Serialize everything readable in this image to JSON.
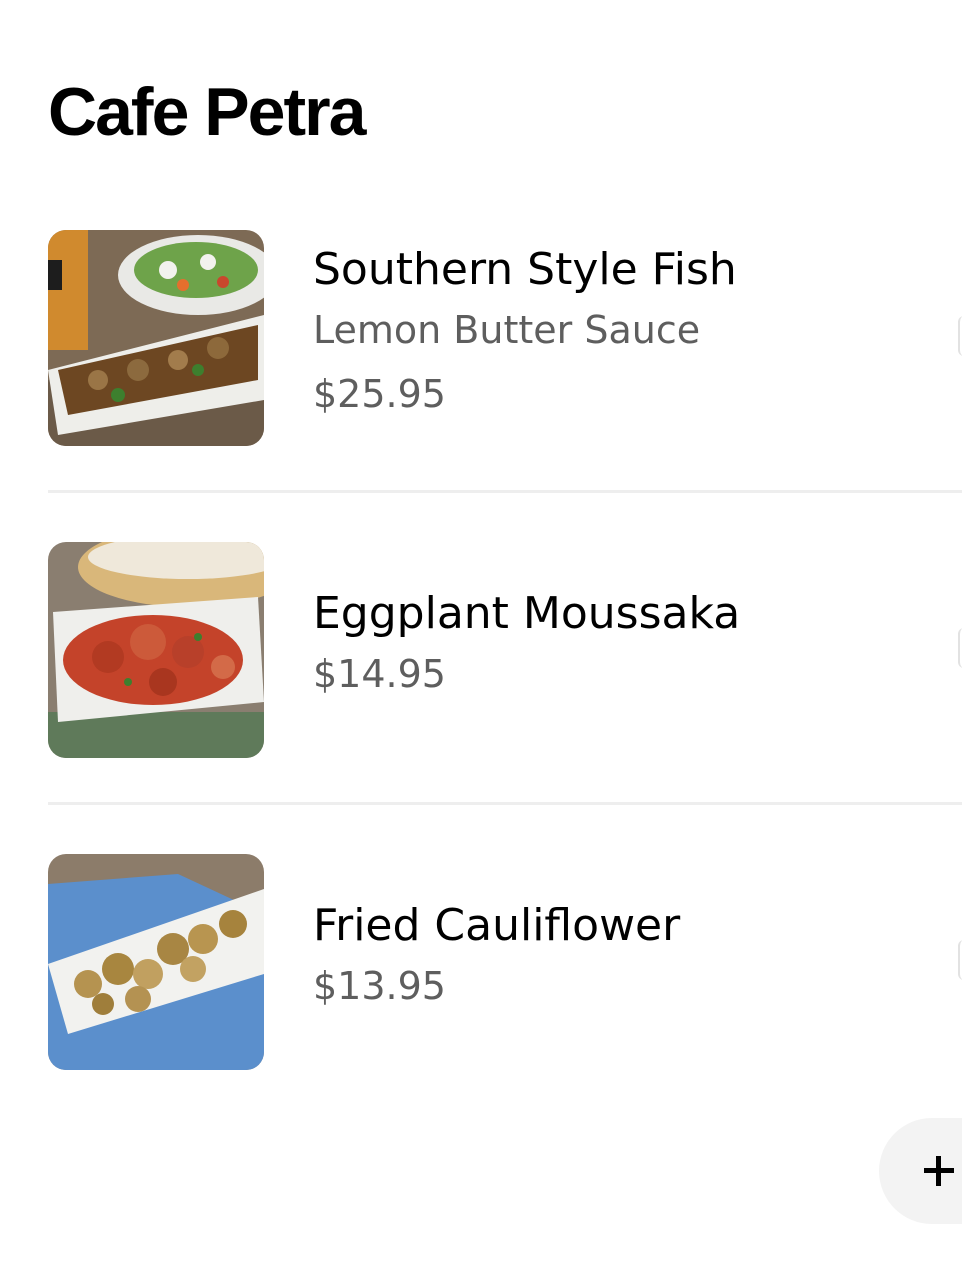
{
  "store": {
    "title": "Cafe Petra"
  },
  "menu": {
    "items": [
      {
        "name": "Southern Style Fish",
        "description": "Lemon Butter Sauce",
        "price": "$25.95",
        "image_icon": "fish-dish-photo"
      },
      {
        "name": "Eggplant Moussaka",
        "description": "",
        "price": "$14.95",
        "image_icon": "moussaka-dish-photo"
      },
      {
        "name": "Fried Cauliflower",
        "description": "",
        "price": "$13.95",
        "image_icon": "cauliflower-dish-photo"
      }
    ]
  },
  "actions": {
    "add_icon": "plus-icon"
  },
  "colors": {
    "text_primary": "#000000",
    "text_secondary": "#5e5e5e",
    "divider": "#eeeeee",
    "fab_background": "#f3f3f3"
  }
}
